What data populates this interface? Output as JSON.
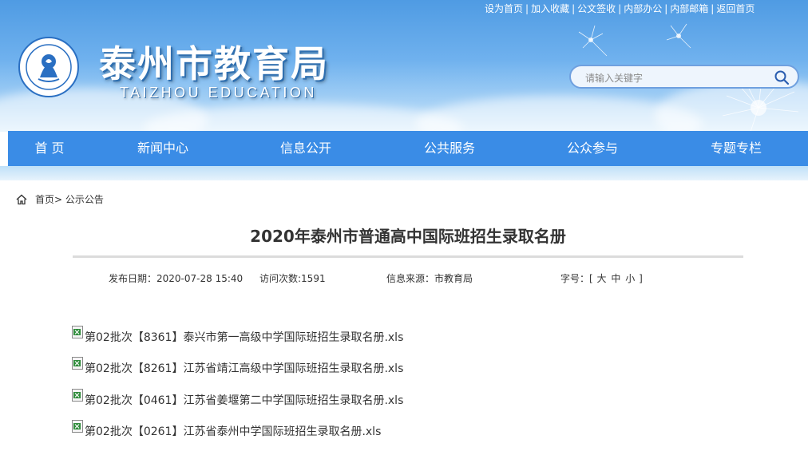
{
  "header": {
    "top_links": [
      "设为首页",
      "加入收藏",
      "公文签收",
      "内部办公",
      "内部邮箱",
      "返回首页"
    ],
    "site_name": "泰州市教育局",
    "site_name_en": "TAIZHOU EDUCATION",
    "search_placeholder": "请输入关键字"
  },
  "nav": {
    "items": [
      "首 页",
      "新闻中心",
      "信息公开",
      "公共服务",
      "公众参与",
      "专题专栏"
    ]
  },
  "breadcrumb": {
    "home": "首页",
    "separator": ">",
    "current": "公示公告"
  },
  "article": {
    "title": "2020年泰州市普通高中国际班招生录取名册",
    "publish_date_label": "发布日期：",
    "publish_date": "2020-07-28 15:40",
    "visits_label": "访问次数:",
    "visits": "1591",
    "source_label": "信息来源：",
    "source": "市教育局",
    "font_size_label": "字号：",
    "font_size_open": "[",
    "font_sizes": [
      "大",
      "中",
      "小"
    ],
    "font_size_close": "]",
    "attachments": [
      "第02批次【8361】泰兴市第一高级中学国际班招生录取名册.xls",
      "第02批次【8261】江苏省靖江高级中学国际班招生录取名册.xls",
      "第02批次【0461】江苏省姜堰第二中学国际班招生录取名册.xls",
      "第02批次【0261】江苏省泰州中学国际班招生录取名册.xls"
    ]
  },
  "colors": {
    "nav_bg": "#3a8ce6",
    "header_top": "#4f9be3",
    "text": "#333333"
  }
}
